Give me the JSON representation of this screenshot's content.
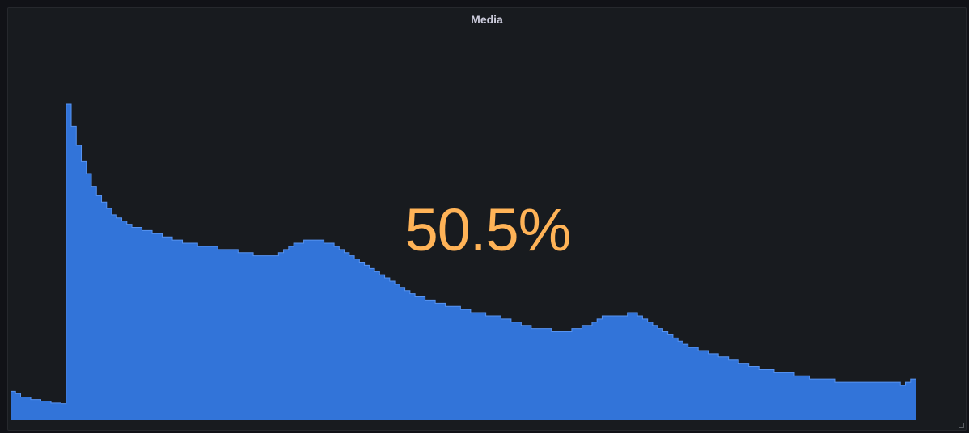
{
  "panel": {
    "title": "Media",
    "value_text": "50.5%",
    "value_color": "#ffb357",
    "series_color": "#3274d9"
  },
  "icons": {
    "resize": "resize-handle-icon"
  },
  "chart_data": {
    "type": "area",
    "title": "Media",
    "xlabel": "",
    "ylabel": "",
    "grid": false,
    "legend": "none",
    "current_value": 50.5,
    "unit": "%",
    "ylim": [
      0,
      100
    ],
    "series": [
      {
        "values": [
          9.1,
          8.4,
          7.3,
          7.3,
          6.5,
          6.5,
          6.0,
          6.0,
          5.4,
          5.4,
          5.2,
          100,
          93,
          87,
          82,
          78,
          74,
          71,
          69,
          67,
          65,
          64,
          63,
          62,
          61,
          61,
          60,
          60,
          59,
          59,
          58,
          58,
          57,
          57,
          56,
          56,
          56,
          55,
          55,
          55,
          55,
          54,
          54,
          54,
          54,
          53,
          53,
          53,
          52,
          52,
          52,
          52,
          52,
          53,
          54,
          55,
          56,
          56,
          57,
          57,
          57,
          57,
          56,
          56,
          55,
          54,
          53,
          52,
          51,
          50,
          49,
          48,
          47,
          46,
          45,
          44,
          43,
          42,
          41,
          40,
          39,
          39,
          38,
          38,
          37,
          37,
          36,
          36,
          36,
          35,
          35,
          34,
          34,
          34,
          33,
          33,
          33,
          32,
          32,
          31,
          31,
          30,
          30,
          29,
          29,
          29,
          29,
          28,
          28,
          28,
          28,
          29,
          29,
          30,
          30,
          31,
          32,
          33,
          33,
          33,
          33,
          33,
          34,
          34,
          33,
          32,
          31,
          30,
          29,
          28,
          27,
          26,
          25,
          24,
          23,
          23,
          22,
          22,
          21,
          21,
          20,
          20,
          19,
          19,
          18,
          18,
          17,
          17,
          16,
          16,
          16,
          15,
          15,
          15,
          15,
          14,
          14,
          14,
          13,
          13,
          13,
          13,
          13,
          12,
          12,
          12,
          12,
          12,
          12,
          12,
          12,
          12,
          12,
          12,
          12,
          12,
          11,
          12,
          13
        ]
      }
    ]
  }
}
